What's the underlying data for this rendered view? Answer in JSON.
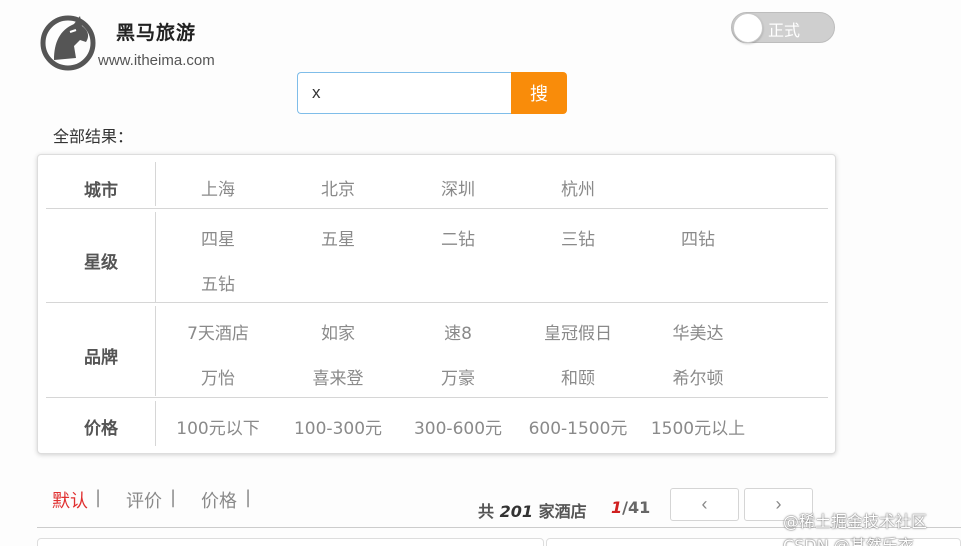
{
  "header": {
    "brand_title": "黑马旅游",
    "brand_url": "www.itheima.com",
    "toggle_label": "正式"
  },
  "search": {
    "value": "x",
    "button_label": "搜"
  },
  "results_label": "全部结果：",
  "filters": {
    "city": {
      "label": "城市",
      "options": [
        "上海",
        "北京",
        "深圳",
        "杭州"
      ]
    },
    "star": {
      "label": "星级",
      "options": [
        "四星",
        "五星",
        "二钻",
        "三钻",
        "四钻",
        "五钻"
      ]
    },
    "brand": {
      "label": "品牌",
      "options": [
        "7天酒店",
        "如家",
        "速8",
        "皇冠假日",
        "华美达",
        "万怡",
        "喜来登",
        "万豪",
        "和颐",
        "希尔顿"
      ]
    },
    "price": {
      "label": "价格",
      "options": [
        "100元以下",
        "100-300元",
        "300-600元",
        "600-1500元",
        "1500元以上"
      ]
    }
  },
  "sort": {
    "items": [
      "默认",
      "评价",
      "价格"
    ],
    "separator": "|",
    "active_index": 0
  },
  "summary": {
    "prefix": "共",
    "count": "201",
    "suffix": "家酒店"
  },
  "pagination": {
    "current": "1",
    "total": "/41",
    "prev_icon": "‹",
    "next_icon": "›"
  },
  "watermark": "@稀土掘金技术社区 CSDN @其然乐衣",
  "colors": {
    "accent": "#f98c0a",
    "active_sort": "#e03030",
    "input_border": "#7fbde9"
  }
}
